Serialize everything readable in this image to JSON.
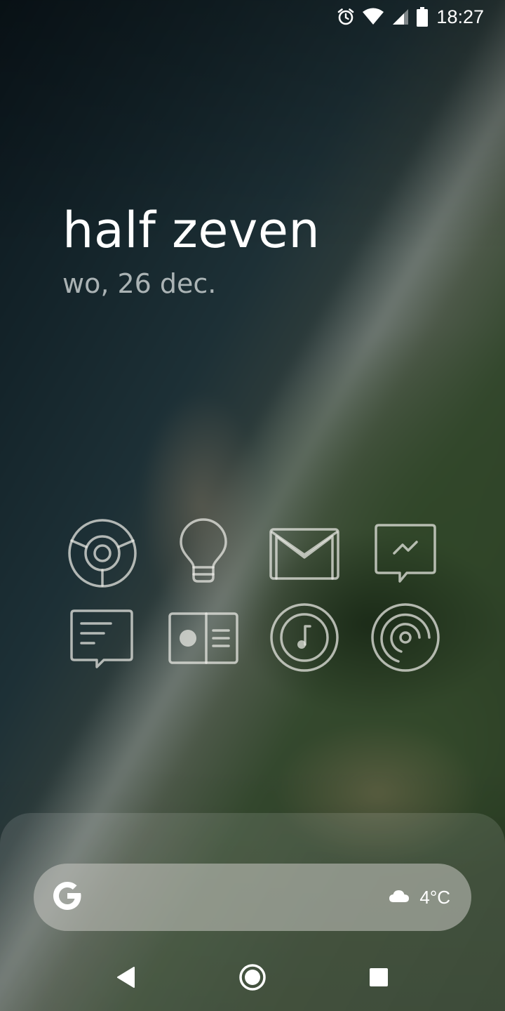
{
  "status_bar": {
    "time": "18:27",
    "icons": [
      "alarm-icon",
      "wifi-icon",
      "signal-icon",
      "battery-icon"
    ]
  },
  "clock_widget": {
    "time_text": "half zeven",
    "date_text": "wo, 26 dec."
  },
  "apps": [
    {
      "icon": "chrome-icon"
    },
    {
      "icon": "lightbulb-icon"
    },
    {
      "icon": "gmail-icon"
    },
    {
      "icon": "messenger-icon"
    },
    {
      "icon": "messages-icon"
    },
    {
      "icon": "news-icon"
    },
    {
      "icon": "music-icon"
    },
    {
      "icon": "podcast-icon"
    }
  ],
  "search_bar": {
    "logo": "google-logo",
    "weather_icon": "cloud-icon",
    "temperature": "4°C"
  },
  "nav_bar": {
    "buttons": [
      "back-icon",
      "home-icon",
      "recents-icon"
    ]
  },
  "colors": {
    "icon_stroke": "#ebebe6",
    "text_primary": "#ffffff",
    "search_bar_bg": "#c8c8c3"
  }
}
